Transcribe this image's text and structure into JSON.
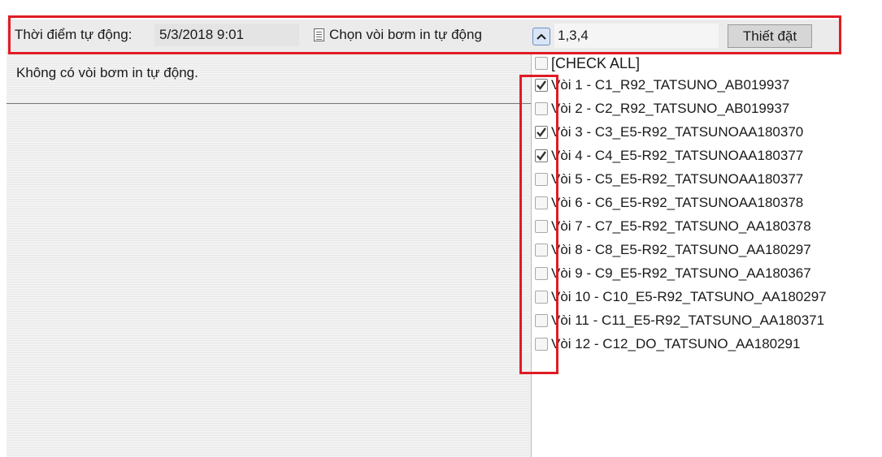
{
  "toolbar": {
    "time_label": "Thời điểm tự động:",
    "time_value": "5/3/2018 9:01",
    "pump_label": "Chọn vòi bơm in tự động",
    "pump_value": "1,3,4",
    "set_button": "Thiết đặt"
  },
  "message": "Không có vòi bơm in tự động.",
  "dropdown": {
    "check_all": "[CHECK ALL]",
    "options": [
      {
        "label": "Vòi 1 - C1_R92_TATSUNO_AB019937",
        "checked": true
      },
      {
        "label": "Vòi 2 - C2_R92_TATSUNO_AB019937",
        "checked": false
      },
      {
        "label": "Vòi 3 - C3_E5-R92_TATSUNOAA180370",
        "checked": true
      },
      {
        "label": "Vòi 4 - C4_E5-R92_TATSUNOAA180377",
        "checked": true
      },
      {
        "label": "Vòi 5 - C5_E5-R92_TATSUNOAA180377",
        "checked": false
      },
      {
        "label": "Vòi 6 - C6_E5-R92_TATSUNOAA180378",
        "checked": false
      },
      {
        "label": "Vòi 7 - C7_E5-R92_TATSUNO_AA180378",
        "checked": false
      },
      {
        "label": "Vòi 8 - C8_E5-R92_TATSUNO_AA180297",
        "checked": false
      },
      {
        "label": "Vòi 9 - C9_E5-R92_TATSUNO_AA180367",
        "checked": false
      },
      {
        "label": "Vòi 10 - C10_E5-R92_TATSUNO_AA180297",
        "checked": false
      },
      {
        "label": "Vòi 11 - C11_E5-R92_TATSUNO_AA180371",
        "checked": false
      },
      {
        "label": "Vòi 12 - C12_DO_TATSUNO_AA180291",
        "checked": false
      }
    ]
  },
  "colors": {
    "highlight_border": "#e01b24",
    "check_mark": "#333333"
  }
}
